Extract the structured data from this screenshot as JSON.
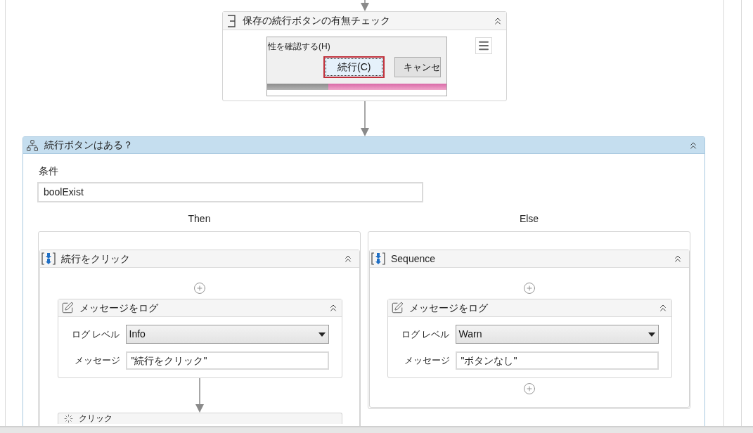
{
  "top_activity": {
    "title": "保存の続行ボタンの有無チェック",
    "preview": {
      "caption": "性を確認する(H)",
      "buttons": [
        {
          "label": "続行(C)",
          "selected": true
        },
        {
          "label": "キャンセ",
          "selected": false
        }
      ]
    }
  },
  "if_activity": {
    "title": "続行ボタンはある？",
    "condition": {
      "label": "条件",
      "value": "boolExist"
    },
    "branches": [
      {
        "label": "Then",
        "sequence": {
          "title": "続行をクリック",
          "activities": [
            {
              "kind": "log",
              "title": "メッセージをログ",
              "fields": [
                {
                  "kind": "dropdown",
                  "label": "ログ レベル",
                  "value": "Info"
                },
                {
                  "kind": "text",
                  "label": "メッセージ",
                  "value": "\"続行をクリック\""
                }
              ]
            },
            {
              "kind": "click",
              "title": "クリック"
            }
          ]
        }
      },
      {
        "label": "Else",
        "sequence": {
          "title": "Sequence",
          "activities": [
            {
              "kind": "log",
              "title": "メッセージをログ",
              "fields": [
                {
                  "kind": "dropdown",
                  "label": "ログ レベル",
                  "value": "Warn"
                },
                {
                  "kind": "text",
                  "label": "メッセージ",
                  "value": "\"ボタンなし\""
                }
              ]
            }
          ]
        }
      }
    ]
  }
}
